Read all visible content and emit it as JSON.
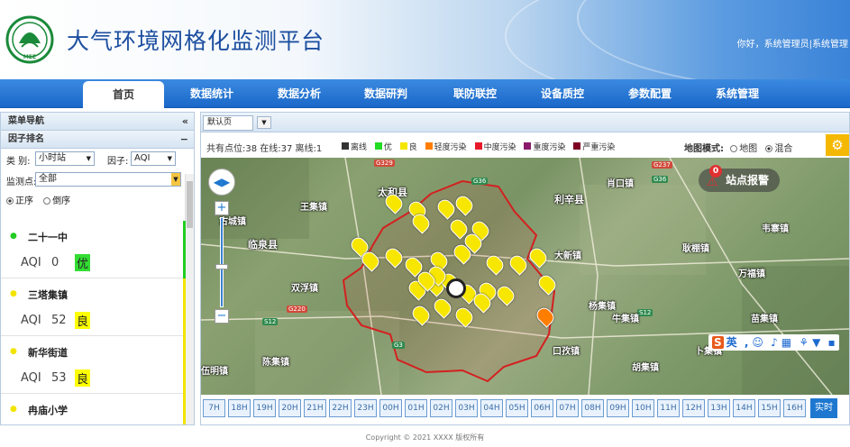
{
  "header": {
    "title": "大气环境网格化监测平台",
    "greeting": "你好，系统管理员|系统管理",
    "logo_text": "MEE"
  },
  "nav": {
    "tabs": [
      {
        "label": "首页",
        "active": true
      },
      {
        "label": "数据统计"
      },
      {
        "label": "数据分析"
      },
      {
        "label": "数据研判"
      },
      {
        "label": "联防联控"
      },
      {
        "label": "设备质控"
      },
      {
        "label": "参数配置"
      },
      {
        "label": "系统管理"
      }
    ]
  },
  "sidebar": {
    "menu_title": "菜单导航",
    "panel_title": "因子排名",
    "type_label": "类 别:",
    "type_value": "小时站",
    "factor_label": "因子:",
    "factor_value": "AQI",
    "site_label": "监测点:",
    "site_value": "全部",
    "order_asc": "正序",
    "order_desc": "倒序",
    "stations": [
      {
        "name": "二十一中",
        "aqi_label": "AQI",
        "aqi": "0",
        "grade": "优",
        "color": "#22cc22",
        "grade_bg": "#33dd33"
      },
      {
        "name": "三塔集镇",
        "aqi_label": "AQI",
        "aqi": "52",
        "grade": "良",
        "color": "#f2e400",
        "grade_bg": "#ffff00"
      },
      {
        "name": "新华街道",
        "aqi_label": "AQI",
        "aqi": "53",
        "grade": "良",
        "color": "#f2e400",
        "grade_bg": "#ffff00"
      },
      {
        "name": "冉庙小学",
        "aqi_label": "AQI",
        "aqi": "",
        "grade": "",
        "color": "#f2e400",
        "grade_bg": "#ffff00"
      }
    ]
  },
  "main": {
    "tab_label": "默认页",
    "stats": "共有点位:38 在线:37 离线:1",
    "legend": [
      {
        "label": "离线",
        "color": "#333333"
      },
      {
        "label": "优",
        "color": "#22dd22"
      },
      {
        "label": "良",
        "color": "#f5e600"
      },
      {
        "label": "轻度污染",
        "color": "#ff7e00"
      },
      {
        "label": "中度污染",
        "color": "#e8192a"
      },
      {
        "label": "重度污染",
        "color": "#8b1a6b"
      },
      {
        "label": "严重污染",
        "color": "#7e0023"
      }
    ],
    "map_mode_label": "地图模式:",
    "map_mode_map": "地图",
    "map_mode_hybrid": "混合",
    "report_label": "站点报警",
    "report_count": "0"
  },
  "map": {
    "places": [
      "太和县",
      "利辛县",
      "王集镇",
      "古城镇",
      "临泉县",
      "肖口镇",
      "大新镇",
      "双浮镇",
      "耿棚镇",
      "韦寨镇",
      "万福镇",
      "杨集镇",
      "牛集镇",
      "陈集镇",
      "苗集镇",
      "伍明镇",
      "口孜镇",
      "胡集镇",
      "卜集镇"
    ],
    "roads": [
      "G329",
      "G36",
      "G237",
      "G36",
      "G220",
      "S12",
      "S12",
      "G3"
    ]
  },
  "hours": {
    "labels": [
      "7H",
      "18H",
      "19H",
      "20H",
      "21H",
      "22H",
      "23H",
      "00H",
      "01H",
      "02H",
      "03H",
      "04H",
      "05H",
      "06H",
      "07H",
      "08H",
      "09H",
      "10H",
      "11H",
      "12H",
      "13H",
      "14H",
      "15H",
      "16H"
    ],
    "realtime": "实时"
  },
  "footer": "Copyright © 2021 XXXX 版权所有"
}
